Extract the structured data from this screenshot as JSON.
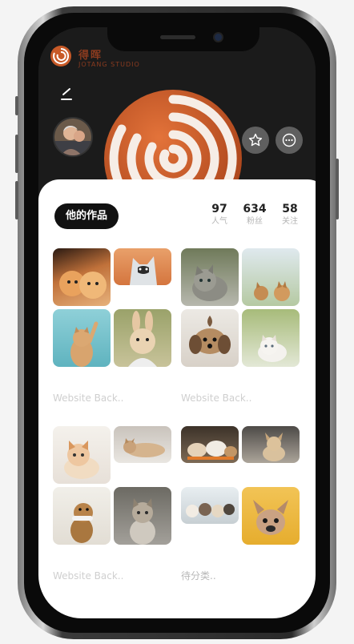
{
  "studio": {
    "name_cn": "得晖",
    "name_en": "JOTANG STUDIO"
  },
  "tab_label": "他的作品",
  "stats": [
    {
      "value": "97",
      "label": "人气"
    },
    {
      "value": "634",
      "label": "粉丝"
    },
    {
      "value": "58",
      "label": "关注"
    }
  ],
  "albums": [
    {
      "title": "Website Back..",
      "photos": [
        "pomeranian-puppies",
        "husky-in-autumn",
        "tabby-cat",
        "dogs-in-grass",
        "kitten-reaching",
        "rabbit-in-hoodie",
        "yorkie-lying",
        "white-kitten"
      ]
    },
    {
      "title": "Website Back..",
      "photos": [
        "orange-kitten",
        "cat-lying-on-rug",
        "guinea-pigs",
        "chihuahua-on-bed",
        "dog-with-bone",
        "cat-in-cage",
        "puppies-row",
        "french-bulldog"
      ]
    }
  ],
  "album_titles": [
    "Website Back..",
    "Website Back..",
    "Website Back..",
    "待分类.."
  ],
  "colors": {
    "accent": "#c85a28",
    "tab_bg": "#111111",
    "stat_label": "#b5b5b5"
  },
  "icons": [
    "back-icon",
    "star-icon",
    "more-icon",
    "logo-icon"
  ]
}
